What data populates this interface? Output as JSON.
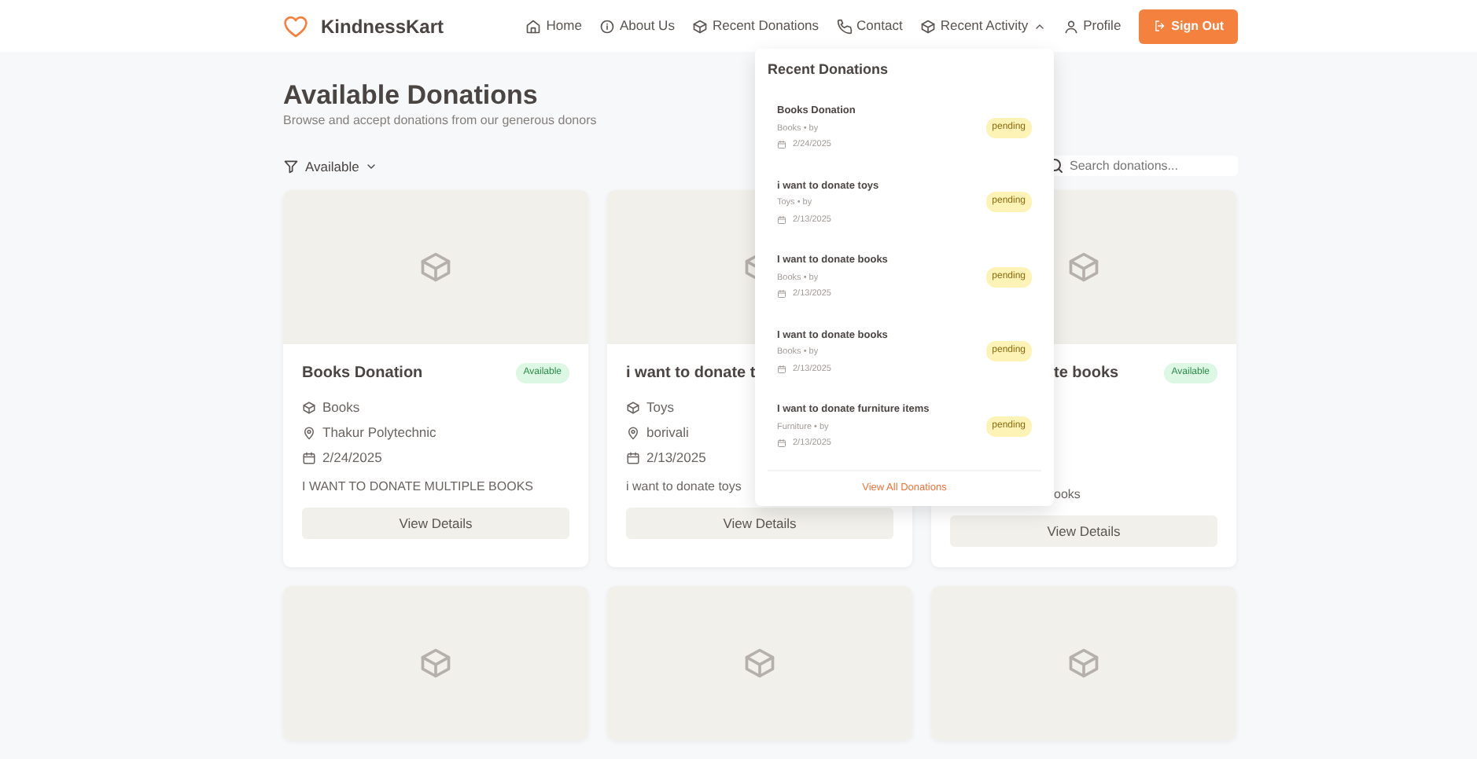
{
  "brand": {
    "name": "KindnessKart"
  },
  "nav": [
    {
      "label": "Home",
      "kind": "link"
    },
    {
      "label": "About Us",
      "kind": "link"
    },
    {
      "label": "Recent Donations",
      "kind": "link"
    },
    {
      "label": "Contact",
      "kind": "link"
    },
    {
      "label": "Recent Activity",
      "kind": "menu",
      "expanded": true
    },
    {
      "label": "Profile",
      "kind": "link"
    }
  ],
  "sign_out": {
    "label": "Sign Out"
  },
  "header": {
    "title": "Available Donations",
    "subtitle": "Browse and accept donations from our generous donors"
  },
  "filter": {
    "label": "Available"
  },
  "search": {
    "placeholder": "Search donations..."
  },
  "donations": [
    {
      "title": "Books Donation",
      "status": "Available",
      "details": [
        {
          "kind": "category",
          "text": "Books"
        },
        {
          "kind": "location",
          "text": "Thakur Polytechnic"
        },
        {
          "kind": "date",
          "text": "2/24/2025"
        }
      ],
      "description": "I WANT TO DONATE MULTIPLE BOOKS",
      "button": "View Details"
    },
    {
      "title": "i want to donate t",
      "details": [
        {
          "kind": "category",
          "text": "Toys"
        },
        {
          "kind": "location",
          "text": "borivali"
        },
        {
          "kind": "date",
          "text": "2/13/2025"
        }
      ],
      "description": "i want to donate toys",
      "button": "View Details"
    },
    {
      "title": "te books",
      "status": "Available",
      "description": "ooks",
      "button": "View Details"
    },
    {
      "kind": "picture"
    },
    {
      "kind": "picture"
    },
    {
      "kind": "picture"
    }
  ],
  "activity_menu": {
    "title": "Recent Donations",
    "items": [
      {
        "title": "Books Donation",
        "meta": "Books • by",
        "date": "2/24/2025",
        "status": "pending"
      },
      {
        "title": "i want to donate toys",
        "meta": "Toys • by",
        "date": "2/13/2025",
        "status": "pending"
      },
      {
        "title": "I want to donate books",
        "meta": "Books • by",
        "date": "2/13/2025",
        "status": "pending"
      },
      {
        "title": "I want to donate books",
        "meta": "Books • by",
        "date": "2/13/2025",
        "status": "pending"
      },
      {
        "title": "I want to donate furniture items",
        "meta": "Furniture • by",
        "date": "2/13/2025",
        "status": "pending"
      }
    ],
    "footer": "View All Donations"
  }
}
